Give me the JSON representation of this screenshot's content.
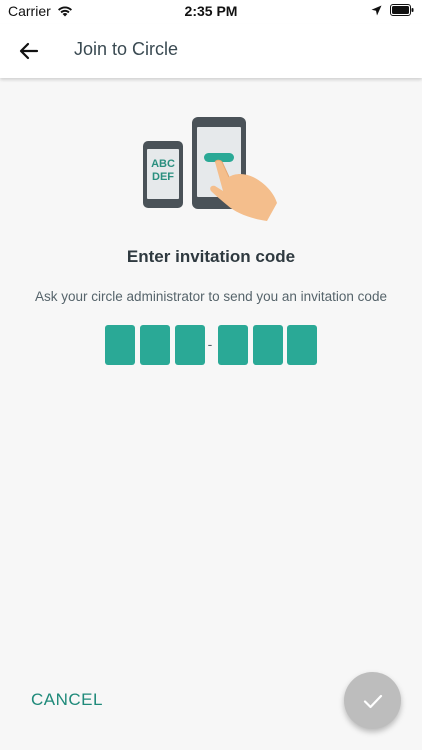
{
  "status_bar": {
    "carrier": "Carrier",
    "time": "2:35 PM"
  },
  "app_bar": {
    "title": "Join to Circle"
  },
  "illustration": {
    "phone_text_line1": "ABC",
    "phone_text_line2": "DEF"
  },
  "main": {
    "headline": "Enter invitation code",
    "subtext": "Ask your circle administrator to send you an invitation code",
    "code_separator": "-"
  },
  "actions": {
    "cancel_label": "CANCEL"
  },
  "colors": {
    "accent": "#2aa996",
    "cancel_text": "#1f8a7a",
    "fab_disabled": "#bdbdbd"
  }
}
